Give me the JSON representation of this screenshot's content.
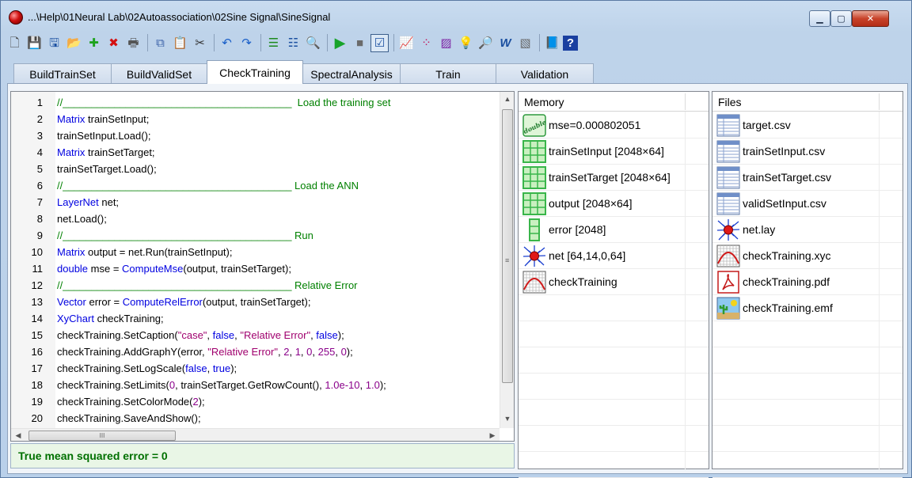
{
  "window": {
    "title": "...\\Help\\01Neural Lab\\02Autoassociation\\02Sine Signal\\SineSignal",
    "min_label": "▁",
    "max_label": "▢",
    "close_label": "✕"
  },
  "toolbar": {
    "items": [
      {
        "icon": "new-file-icon",
        "glyph": "🗋"
      },
      {
        "icon": "save-icon",
        "glyph": "💾"
      },
      {
        "icon": "save-as-icon",
        "glyph": "🖫"
      },
      {
        "icon": "open-folder-icon",
        "glyph": "📂"
      },
      {
        "icon": "add-icon",
        "glyph": "✚"
      },
      {
        "icon": "delete-icon",
        "glyph": "✖"
      },
      {
        "icon": "print-icon",
        "glyph": "🖶"
      },
      {
        "icon": "copy-icon",
        "glyph": "⧉"
      },
      {
        "icon": "paste-icon",
        "glyph": "📋"
      },
      {
        "icon": "cut-icon",
        "glyph": "✂"
      },
      {
        "icon": "undo-icon",
        "glyph": "↶"
      },
      {
        "icon": "redo-icon",
        "glyph": "↷"
      },
      {
        "icon": "indent-icon",
        "glyph": "☰"
      },
      {
        "icon": "outdent-icon",
        "glyph": "☷"
      },
      {
        "icon": "variables-icon",
        "glyph": "🔍"
      },
      {
        "icon": "run-icon",
        "glyph": "▶"
      },
      {
        "icon": "stop-icon",
        "glyph": "■"
      },
      {
        "icon": "check-icon",
        "glyph": "☑"
      },
      {
        "icon": "chart-icon",
        "glyph": "📈"
      },
      {
        "icon": "scatter-icon",
        "glyph": "⁘"
      },
      {
        "icon": "color-palette-icon",
        "glyph": "▨"
      },
      {
        "icon": "lightbulb-icon",
        "glyph": "💡"
      },
      {
        "icon": "magnifier-icon",
        "glyph": "🔎"
      },
      {
        "icon": "word-icon",
        "glyph": "W"
      },
      {
        "icon": "image-icon",
        "glyph": "▧"
      },
      {
        "icon": "book-icon",
        "glyph": "📘"
      },
      {
        "icon": "help-icon",
        "glyph": "?"
      }
    ]
  },
  "tabs": [
    {
      "label": "BuildTrainSet",
      "active": false
    },
    {
      "label": "BuildValidSet",
      "active": false
    },
    {
      "label": "CheckTraining",
      "active": true
    },
    {
      "label": "SpectralAnalysis",
      "active": false
    },
    {
      "label": "Train",
      "active": false
    },
    {
      "label": "Validation",
      "active": false
    }
  ],
  "editor": {
    "lines": [
      {
        "n": "1",
        "segs": [
          {
            "t": "//________________________________________  Load the training set",
            "c": "cm"
          }
        ]
      },
      {
        "n": "2",
        "segs": [
          {
            "t": "Matrix",
            "c": "kw"
          },
          {
            "t": " trainSetInput;",
            "c": ""
          }
        ]
      },
      {
        "n": "3",
        "segs": [
          {
            "t": "trainSetInput.Load();",
            "c": ""
          }
        ]
      },
      {
        "n": "4",
        "segs": [
          {
            "t": "Matrix",
            "c": "kw"
          },
          {
            "t": " trainSetTarget;",
            "c": ""
          }
        ]
      },
      {
        "n": "5",
        "segs": [
          {
            "t": "trainSetTarget.Load();",
            "c": ""
          }
        ]
      },
      {
        "n": "6",
        "segs": [
          {
            "t": "//________________________________________ Load the ANN",
            "c": "cm"
          }
        ]
      },
      {
        "n": "7",
        "segs": [
          {
            "t": "LayerNet",
            "c": "kw"
          },
          {
            "t": " net;",
            "c": ""
          }
        ]
      },
      {
        "n": "8",
        "segs": [
          {
            "t": "net.Load();",
            "c": ""
          }
        ]
      },
      {
        "n": "9",
        "segs": [
          {
            "t": "//________________________________________ Run",
            "c": "cm"
          }
        ]
      },
      {
        "n": "10",
        "segs": [
          {
            "t": "Matrix",
            "c": "kw"
          },
          {
            "t": " output = net.Run(trainSetInput);",
            "c": ""
          }
        ]
      },
      {
        "n": "11",
        "segs": [
          {
            "t": "double",
            "c": "kw"
          },
          {
            "t": " mse = ",
            "c": ""
          },
          {
            "t": "ComputeMse",
            "c": "kw"
          },
          {
            "t": "(output, trainSetTarget);",
            "c": ""
          }
        ]
      },
      {
        "n": "12",
        "segs": [
          {
            "t": "//________________________________________ Relative Error",
            "c": "cm"
          }
        ]
      },
      {
        "n": "13",
        "segs": [
          {
            "t": "Vector",
            "c": "kw"
          },
          {
            "t": " error = ",
            "c": ""
          },
          {
            "t": "ComputeRelError",
            "c": "kw"
          },
          {
            "t": "(output, trainSetTarget);",
            "c": ""
          }
        ]
      },
      {
        "n": "14",
        "segs": [
          {
            "t": "XyChart",
            "c": "kw"
          },
          {
            "t": " checkTraining;",
            "c": ""
          }
        ]
      },
      {
        "n": "15",
        "segs": [
          {
            "t": "checkTraining.SetCaption(",
            "c": ""
          },
          {
            "t": "\"case\"",
            "c": "st"
          },
          {
            "t": ", ",
            "c": ""
          },
          {
            "t": "false",
            "c": "kw"
          },
          {
            "t": ", ",
            "c": ""
          },
          {
            "t": "\"Relative Error\"",
            "c": "st"
          },
          {
            "t": ", ",
            "c": ""
          },
          {
            "t": "false",
            "c": "kw"
          },
          {
            "t": ");",
            "c": ""
          }
        ]
      },
      {
        "n": "16",
        "segs": [
          {
            "t": "checkTraining.AddGraphY(error, ",
            "c": ""
          },
          {
            "t": "\"Relative Error\"",
            "c": "st"
          },
          {
            "t": ", ",
            "c": ""
          },
          {
            "t": "2",
            "c": "nu"
          },
          {
            "t": ", ",
            "c": ""
          },
          {
            "t": "1",
            "c": "nu"
          },
          {
            "t": ", ",
            "c": ""
          },
          {
            "t": "0",
            "c": "nu"
          },
          {
            "t": ", ",
            "c": ""
          },
          {
            "t": "255",
            "c": "nu"
          },
          {
            "t": ", ",
            "c": ""
          },
          {
            "t": "0",
            "c": "nu"
          },
          {
            "t": ");",
            "c": ""
          }
        ]
      },
      {
        "n": "17",
        "segs": [
          {
            "t": "checkTraining.SetLogScale(",
            "c": ""
          },
          {
            "t": "false",
            "c": "kw"
          },
          {
            "t": ", ",
            "c": ""
          },
          {
            "t": "true",
            "c": "kw"
          },
          {
            "t": ");",
            "c": ""
          }
        ]
      },
      {
        "n": "18",
        "segs": [
          {
            "t": "checkTraining.SetLimits(",
            "c": ""
          },
          {
            "t": "0",
            "c": "nu"
          },
          {
            "t": ", trainSetTarget.GetRowCount(), ",
            "c": ""
          },
          {
            "t": "1.0e-10",
            "c": "nu"
          },
          {
            "t": ", ",
            "c": ""
          },
          {
            "t": "1.0",
            "c": "nu"
          },
          {
            "t": ");",
            "c": ""
          }
        ]
      },
      {
        "n": "19",
        "segs": [
          {
            "t": "checkTraining.SetColorMode(",
            "c": ""
          },
          {
            "t": "2",
            "c": "nu"
          },
          {
            "t": ");",
            "c": ""
          }
        ]
      },
      {
        "n": "20",
        "segs": [
          {
            "t": "checkTraining.SaveAndShow();",
            "c": ""
          }
        ]
      }
    ],
    "scroll_up": "▲",
    "scroll_down": "▼",
    "scroll_left": "◀",
    "scroll_right": "▶",
    "thumb_grip_v": "≡",
    "thumb_grip_h": "III"
  },
  "status": {
    "text": "True mean squared error = 0"
  },
  "memory": {
    "header": "Memory",
    "items": [
      {
        "label": "mse=0.000802051",
        "icon": "double-icon",
        "icon_text": "double"
      },
      {
        "label": "trainSetInput [2048×64]",
        "icon": "matrix-icon"
      },
      {
        "label": "trainSetTarget [2048×64]",
        "icon": "matrix-icon"
      },
      {
        "label": "output [2048×64]",
        "icon": "matrix-icon"
      },
      {
        "label": "error [2048]",
        "icon": "vector-icon"
      },
      {
        "label": "net [64,14,0,64]",
        "icon": "neural-net-icon"
      },
      {
        "label": "checkTraining",
        "icon": "xy-chart-icon"
      }
    ]
  },
  "files": {
    "header": "Files",
    "items": [
      {
        "label": "target.csv",
        "icon": "csv-file-icon"
      },
      {
        "label": "trainSetInput.csv",
        "icon": "csv-file-icon"
      },
      {
        "label": "trainSetTarget.csv",
        "icon": "csv-file-icon"
      },
      {
        "label": "validSetInput.csv",
        "icon": "csv-file-icon"
      },
      {
        "label": "net.lay",
        "icon": "neural-net-icon"
      },
      {
        "label": "checkTraining.xyc",
        "icon": "xy-chart-icon"
      },
      {
        "label": "checkTraining.pdf",
        "icon": "pdf-file-icon"
      },
      {
        "label": "checkTraining.emf",
        "icon": "image-file-icon"
      }
    ]
  },
  "colors": {
    "keyword": "#0000e0",
    "comment": "#008000",
    "string": "#a0006e",
    "status_text": "#007000",
    "grid_green": "#39b54a"
  }
}
